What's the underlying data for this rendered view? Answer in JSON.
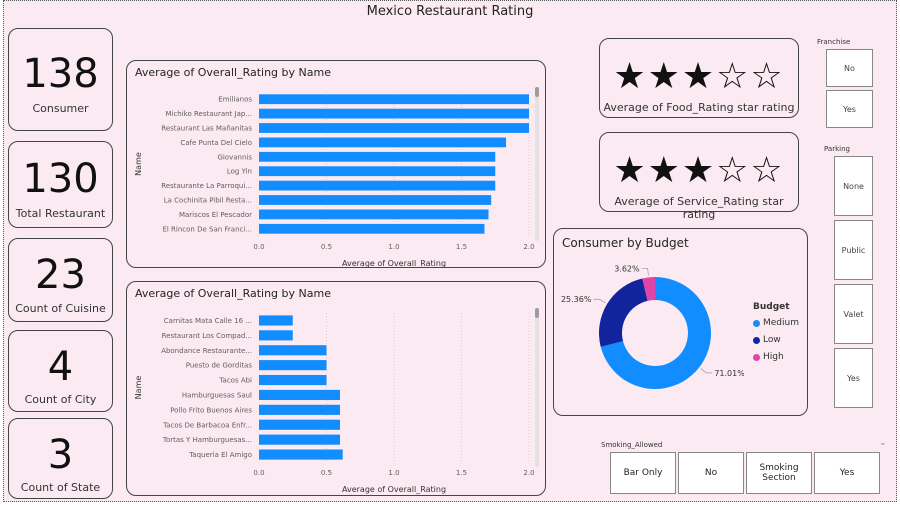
{
  "title": "Mexico Restaurant Rating",
  "kpis": [
    {
      "value": "138",
      "label": "Consumer"
    },
    {
      "value": "130",
      "label": "Total Restaurant"
    },
    {
      "value": "23",
      "label": "Count of Cuisine"
    },
    {
      "value": "4",
      "label": "Count of City"
    },
    {
      "value": "3",
      "label": "Count of State"
    }
  ],
  "ratings": [
    {
      "stars": "★★★☆☆",
      "rating": 3,
      "max": 5,
      "label": "Average of Food_Rating star rating"
    },
    {
      "stars": "★★★☆☆",
      "rating": 3,
      "max": 5,
      "label": "Average of Service_Rating star rating"
    }
  ],
  "chart_data": [
    {
      "type": "bar",
      "orientation": "horizontal",
      "title": "Average of Overall_Rating by Name",
      "xlabel": "Average of Overall_Rating",
      "ylabel": "Name",
      "xlim": [
        0,
        2.0
      ],
      "xticks": [
        "0.0",
        "0.5",
        "1.0",
        "1.5",
        "2.0"
      ],
      "color": "#118dff",
      "categories": [
        "Emilianos",
        "Michiko Restaurant Jap...",
        "Restaurant Las Mañanitas",
        "Cafe Punta Del Cielo",
        "Giovannis",
        "Log Yin",
        "Restaurante La Parroqui...",
        "La Cochinita Pibil Resta...",
        "Mariscos El Pescador",
        "El Rincon De San Franci..."
      ],
      "values": [
        2.0,
        2.0,
        2.0,
        1.83,
        1.75,
        1.75,
        1.75,
        1.72,
        1.7,
        1.67
      ]
    },
    {
      "type": "bar",
      "orientation": "horizontal",
      "title": "Average of Overall_Rating by Name",
      "xlabel": "Average of Overall_Rating",
      "ylabel": "Name",
      "xlim": [
        0,
        2.0
      ],
      "xticks": [
        "0.0",
        "0.5",
        "1.0",
        "1.5",
        "2.0"
      ],
      "color": "#118dff",
      "categories": [
        "Carnitas Mata Calle 16 ...",
        "Restaurant Los Compad...",
        "Abondance Restaurante...",
        "Puesto de Gorditas",
        "Tacos Abi",
        "Hamburguesas Saul",
        "Pollo Frito Buenos Aires",
        "Tacos De Barbacoa Enfr...",
        "Tortas Y Hamburguesas...",
        "Taqueria El Amigo"
      ],
      "values": [
        0.25,
        0.25,
        0.5,
        0.5,
        0.5,
        0.6,
        0.6,
        0.6,
        0.6,
        0.62
      ]
    },
    {
      "type": "pie",
      "donut": true,
      "title": "Consumer by Budget",
      "legend_title": "Budget",
      "legend_position": "right",
      "categories": [
        "Medium",
        "Low",
        "High"
      ],
      "values": [
        71.01,
        25.36,
        3.62
      ],
      "labels": [
        "71.01%",
        "25.36%",
        "3.62%"
      ],
      "colors": [
        "#118dff",
        "#12239e",
        "#e044a7"
      ]
    }
  ],
  "slicers": {
    "franchise": {
      "title": "Franchise",
      "options": [
        "No",
        "Yes"
      ]
    },
    "parking": {
      "title": "Parking",
      "options": [
        "None",
        "Public",
        "Valet",
        "Yes"
      ]
    },
    "smoking": {
      "title": "Smoking_Allowed",
      "options": [
        "Bar Only",
        "No",
        "Smoking Section",
        "Yes"
      ]
    }
  }
}
